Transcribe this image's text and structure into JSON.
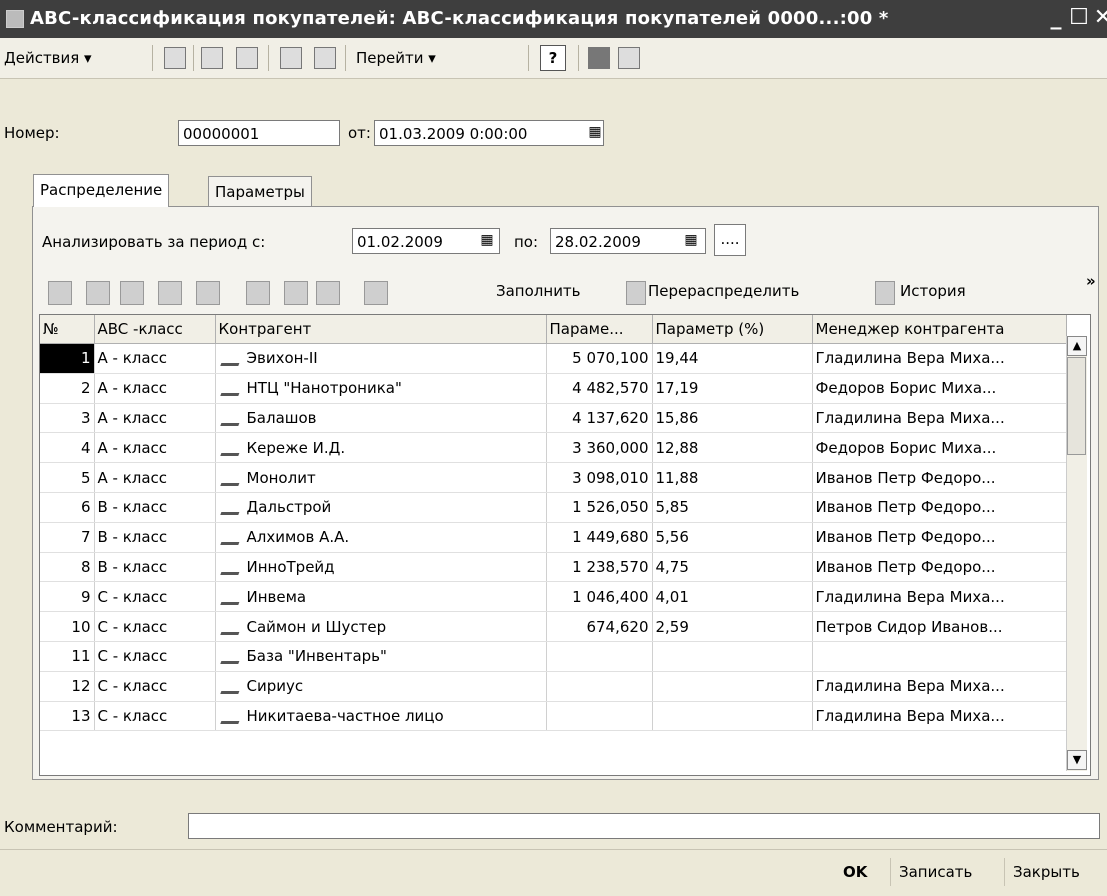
{
  "window": {
    "title": "ABC-классификация покупателей: ABC-классификация покупателей 0000...:00 *",
    "minimize": "_",
    "maximize": "☐",
    "close": "✕"
  },
  "toolbar": {
    "actions_label": "Действия ▾",
    "goto_label": "Перейти ▾",
    "help_label": "?"
  },
  "header": {
    "number_label": "Номер:",
    "number_value": "00000001",
    "from_label": "от:",
    "date_value": "01.03.2009  0:00:00"
  },
  "tabs": [
    {
      "label": "Распределение",
      "active": true
    },
    {
      "label": "Параметры",
      "active": false
    }
  ],
  "period": {
    "label": "Анализировать за период с:",
    "from_value": "01.02.2009",
    "to_label": "по:",
    "to_value": "28.02.2009",
    "more_btn": "...."
  },
  "table_toolbar": {
    "fill_label": "Заполнить",
    "redistribute_label": "Перераспределить",
    "history_label": "История",
    "more": "»"
  },
  "table": {
    "columns": [
      "№",
      "ABC -класс",
      "Контрагент",
      "Параме...",
      "Параметр (%)",
      "Менеджер контрагента"
    ],
    "rows": [
      [
        "1",
        "А - класс",
        "Эвихон-II",
        "5 070,100",
        "19,44",
        "Гладилина Вера Миха..."
      ],
      [
        "2",
        "А - класс",
        "НТЦ \"Нанотроника\"",
        "4 482,570",
        "17,19",
        "Федоров Борис Миха..."
      ],
      [
        "3",
        "А - класс",
        "Балашов",
        "4 137,620",
        "15,86",
        "Гладилина Вера Миха..."
      ],
      [
        "4",
        "А - класс",
        "Кереже И.Д.",
        "3 360,000",
        "12,88",
        "Федоров Борис Миха..."
      ],
      [
        "5",
        "А - класс",
        "Монолит",
        "3 098,010",
        "11,88",
        "Иванов Петр Федоро..."
      ],
      [
        "6",
        "В - класс",
        "Дальстрой",
        "1 526,050",
        "5,85",
        "Иванов Петр Федоро..."
      ],
      [
        "7",
        "В - класс",
        "Алхимов А.А.",
        "1 449,680",
        "5,56",
        "Иванов Петр Федоро..."
      ],
      [
        "8",
        "В - класс",
        "ИнноТрейд",
        "1 238,570",
        "4,75",
        "Иванов Петр Федоро..."
      ],
      [
        "9",
        "С - класс",
        "Инвема",
        "1 046,400",
        "4,01",
        "Гладилина Вера Миха..."
      ],
      [
        "10",
        "С - класс",
        "Саймон и Шустер",
        "674,620",
        "2,59",
        "Петров Сидор Иванов..."
      ],
      [
        "11",
        "С - класс",
        "База \"Инвентарь\"",
        "",
        "",
        ""
      ],
      [
        "12",
        "С - класс",
        "Сириус",
        "",
        "",
        "Гладилина Вера Миха..."
      ],
      [
        "13",
        "С - класс",
        "Никитаева-частное лицо",
        "",
        "",
        "Гладилина Вера Миха..."
      ]
    ]
  },
  "comment": {
    "label": "Комментарий:",
    "value": ""
  },
  "buttons": {
    "ok": "OK",
    "save": "Записать",
    "close": "Закрыть"
  }
}
